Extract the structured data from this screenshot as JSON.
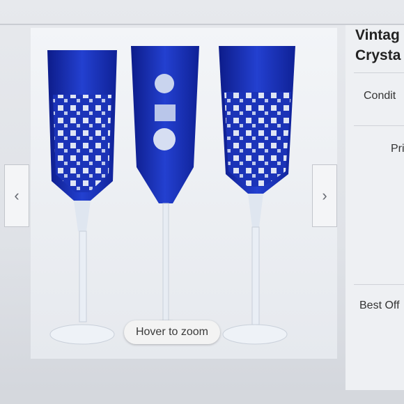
{
  "gallery": {
    "zoom_hint": "Hover to zoom",
    "prev_icon": "chevron-left-icon",
    "next_icon": "chevron-right-icon"
  },
  "listing": {
    "title_line1": "Vintag",
    "title_line2": "Crysta",
    "condition_label": "Condit",
    "price_label": "Pri",
    "best_offer_label": "Best Off"
  },
  "colors": {
    "cobalt": "#1a2fb5",
    "crystal": "#e8edf5"
  }
}
